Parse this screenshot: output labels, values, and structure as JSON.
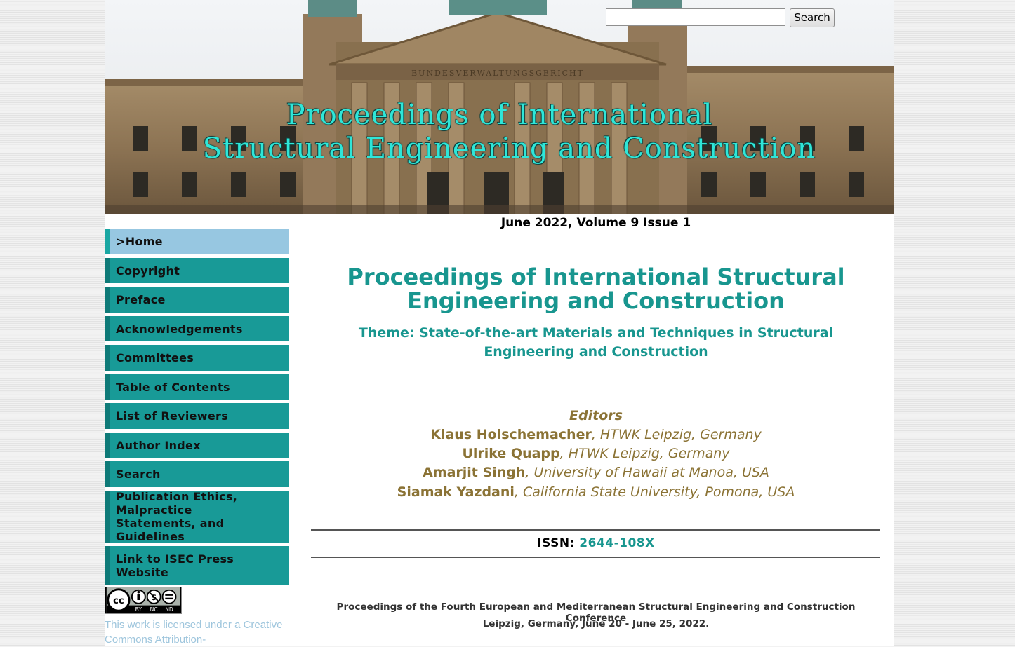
{
  "header": {
    "title_line1": "Proceedings of International",
    "title_line2": "Structural Engineering and Construction",
    "building_inscription": "BUNDESVERWALTUNGSGERICHT",
    "search_placeholder": "",
    "search_button": "Search"
  },
  "sidebar": {
    "items": [
      {
        "label": ">Home",
        "active": true
      },
      {
        "label": "Copyright"
      },
      {
        "label": "Preface"
      },
      {
        "label": "Acknowledgements"
      },
      {
        "label": "Committees"
      },
      {
        "label": "Table of Contents"
      },
      {
        "label": "List of Reviewers"
      },
      {
        "label": "Author Index"
      },
      {
        "label": "Search"
      },
      {
        "label": "Publication Ethics, Malpractice Statements, and Guidelines"
      },
      {
        "label": "Link to ISEC Press Website"
      }
    ],
    "license_badge": {
      "cc": "cc",
      "by": "BY",
      "nc": "NC",
      "nd": "ND"
    },
    "license_text": "This work is licensed under a Creative Commons Attribution-"
  },
  "main": {
    "issue_line": "June 2022, Volume 9 Issue 1",
    "title": "Proceedings of International Structural Engineering and Construction",
    "theme": "Theme: State-of-the-art Materials and Techniques in Structural Engineering and Construction",
    "editors_heading": "Editors",
    "editors": [
      {
        "name": "Klaus Holschemacher",
        "affiliation": ", HTWK Leipzig, Germany"
      },
      {
        "name": "Ulrike Quapp",
        "affiliation": ", HTWK Leipzig, Germany"
      },
      {
        "name": "Amarjit Singh",
        "affiliation": ", University of Hawaii at Manoa, USA"
      },
      {
        "name": "Siamak Yazdani",
        "affiliation": ", California State University, Pomona, USA"
      }
    ],
    "issn_label": "ISSN: ",
    "issn_value": "2644-108X",
    "conference_line1": "Proceedings of the Fourth European and Mediterranean Structural Engineering and Construction Conference",
    "conference_line2": "Leipzig, Germany, June 20 - June 25, 2022."
  },
  "colors": {
    "accent_teal": "#18968f",
    "nav_teal": "#189a97",
    "nav_active": "#97c7e1",
    "editor_brown": "#8b7335",
    "banner_title": "#2fe6d8",
    "license_link": "#9fc6dd"
  }
}
